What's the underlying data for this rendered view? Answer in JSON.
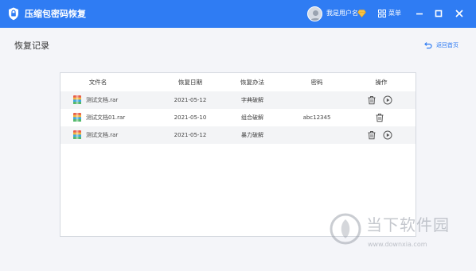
{
  "titlebar": {
    "app_title": "压缩包密码恢复",
    "username": "我是用户名",
    "menu_label": "菜单",
    "brand_color": "#2f7cf3"
  },
  "page": {
    "title": "恢复记录",
    "back_label": "返回首页"
  },
  "table": {
    "headers": [
      "文件名",
      "恢复日期",
      "恢复办法",
      "密码",
      "操作"
    ],
    "rows": [
      {
        "file": "测试文档.rar",
        "date": "2021-05-12",
        "method": "字典破解",
        "password": ""
      },
      {
        "file": "测试文档01.rar",
        "date": "2021-05-10",
        "method": "组合破解",
        "password": "abc12345"
      },
      {
        "file": "测试文档.rar",
        "date": "2021-05-12",
        "method": "暴力破解",
        "password": ""
      }
    ]
  },
  "watermark": {
    "title": "当下软件园",
    "url": "www.downxia.com"
  },
  "icons": [
    "shield-icon",
    "vip-diamond-icon",
    "grid-menu-icon",
    "minimize-icon",
    "maximize-icon",
    "close-icon",
    "back-arrow-icon",
    "rar-file-icon",
    "delete-icon",
    "play-icon"
  ]
}
